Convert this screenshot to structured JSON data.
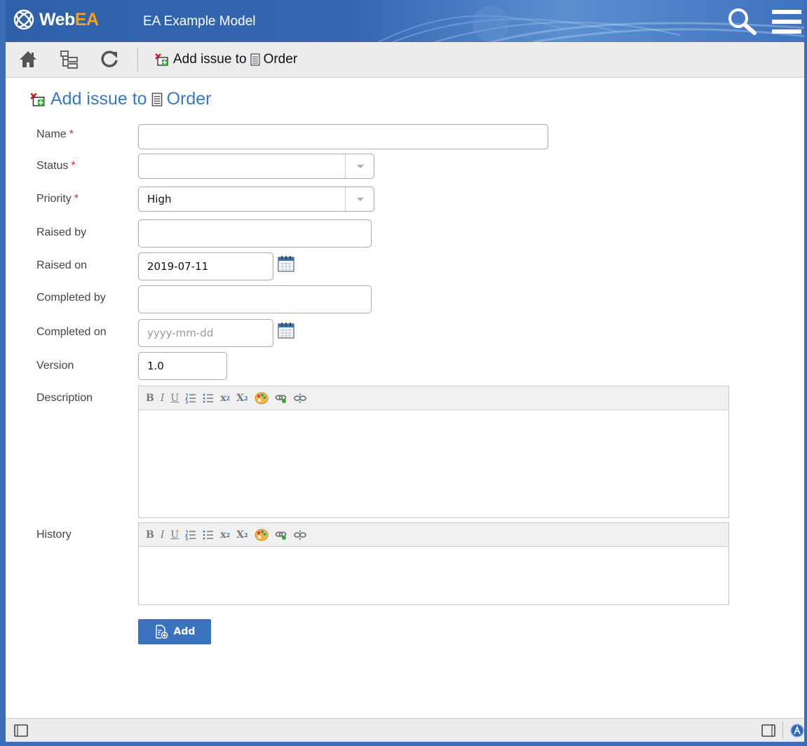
{
  "header": {
    "logo_web": "Web",
    "logo_ea": "EA",
    "model_title": "EA Example Model",
    "icons": [
      "webea-logo-icon",
      "search-icon",
      "hamburger-menu-icon"
    ]
  },
  "toolbar": {
    "icons": [
      "home-icon",
      "browser-tree-icon",
      "refresh-icon"
    ],
    "crumb_action": "Add issue to",
    "crumb_target": "Order"
  },
  "page": {
    "title_action": "Add issue to",
    "title_target": "Order"
  },
  "form": {
    "name_label": "Name",
    "status_label": "Status",
    "priority_label": "Priority",
    "raised_by_label": "Raised by",
    "raised_on_label": "Raised on",
    "completed_by_label": "Completed by",
    "completed_on_label": "Completed on",
    "version_label": "Version",
    "description_label": "Description",
    "history_label": "History",
    "required_mark": "*",
    "name_value": "",
    "status_value": "",
    "priority_value": "High",
    "raised_by_value": "",
    "raised_on_value": "2019-07-11",
    "completed_by_value": "",
    "completed_on_placeholder": "yyyy-mm-dd",
    "version_value": "1.0"
  },
  "editor": {
    "bold": "B",
    "italic": "I",
    "underline": "U",
    "superscript_base": "x",
    "superscript_mark": "2",
    "subscript_base": "X",
    "subscript_mark": "2"
  },
  "actions": {
    "add_label": "Add"
  },
  "colors": {
    "brand_blue": "#3a6fb8",
    "title_blue": "#3a78c3",
    "logo_orange": "#f7a21b",
    "required_red": "#d42b2b",
    "button_blue": "#3a72bd"
  }
}
